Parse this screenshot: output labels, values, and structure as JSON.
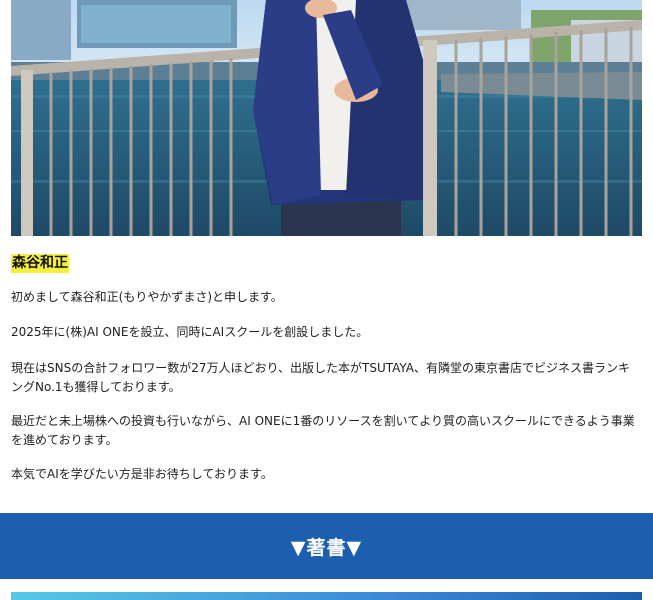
{
  "profile": {
    "photo_label": "man-on-waterfront-photo",
    "name": "森谷和正",
    "paragraphs": [
      "初めまして森谷和正(もりやかずまさ)と申します。",
      "2025年に(株)AI ONEを設立、同時にAIスクールを創設しました。",
      "現在はSNSの合計フォロワー数が27万人ほどおり、出版した本がTSUTAYA、有隣堂の東京書店でビジネス書ランキングNo.1も獲得しております。",
      "最近だと未上場株への投資も行いながら、AI ONEに1番のリソースを割いてより質の高いスクールにできるよう事業を進めております。",
      "本気でAIを学びたい方是非お待ちしております。"
    ]
  },
  "books": {
    "heading": "▼著書▼"
  },
  "colors": {
    "highlight": "#f5ee3d",
    "banner": "#1b5fae"
  }
}
